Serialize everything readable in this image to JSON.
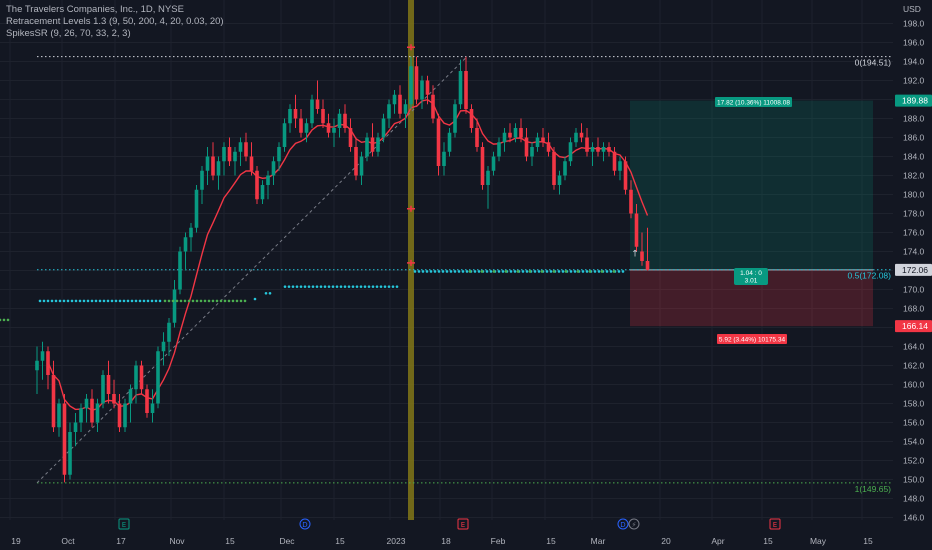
{
  "legend": {
    "symbol": "The Travelers Companies, Inc., 1D, NYSE",
    "indicator1": "Retracement Levels 1.3 (9, 50, 200, 4, 20, 0.03, 20)",
    "indicator2": "SpikesSR (9, 26, 70, 33, 2, 3)"
  },
  "price_axis": {
    "currency": "USD",
    "labels": [
      146,
      148,
      150,
      152,
      154,
      156,
      158,
      160,
      162,
      164,
      166,
      168,
      170,
      172,
      174,
      176,
      178,
      180,
      182,
      184,
      186,
      188,
      190,
      192,
      194,
      196,
      198
    ],
    "tags": [
      {
        "text": "189.88",
        "value": 189.88,
        "bg": "#089981"
      },
      {
        "text": "172.06",
        "value": 172.06,
        "bg": "#d1d4dc"
      },
      {
        "text": "166.14",
        "value": 166.14,
        "bg": "#f23645"
      }
    ]
  },
  "time_axis": {
    "labels": [
      "19",
      "Oct",
      "17",
      "Nov",
      "15",
      "Dec",
      "15",
      "2023",
      "18",
      "Feb",
      "15",
      "Mar",
      "20",
      "Apr",
      "15",
      "May",
      "15"
    ]
  },
  "retracement_labels": [
    {
      "text": "0(194.51)",
      "value": 194.51,
      "color": "#d1d4dc"
    },
    {
      "text": "0.5(172.08)",
      "value": 172.08,
      "color": "#26c6da"
    },
    {
      "text": "1(149.65)",
      "value": 149.65,
      "color": "#4caf50"
    }
  ],
  "position_tool": {
    "target_text": "17.82 (10.36%) 11008.08",
    "entry_text": "1.04 : 0",
    "entry_text2": "3.01",
    "stop_text": "5.92 (3.44%) 10175.34",
    "target": 189.88,
    "entry": 172.06,
    "stop": 166.14,
    "profit_color": "#089981",
    "loss_color": "#f23645"
  },
  "event_markers": [
    {
      "letter": "E",
      "date": "Oct 17",
      "color": "#089981"
    },
    {
      "letter": "D",
      "date": "Dec 8",
      "color": "#2962ff"
    },
    {
      "letter": "E",
      "date": "Jan 24",
      "color": "#f23645"
    },
    {
      "letter": "D",
      "date": "Mar 9",
      "color": "#2962ff"
    },
    {
      "letter": "⚡",
      "date": "Mar 10",
      "color": "#787b86"
    },
    {
      "letter": "E",
      "date": "Apr 20",
      "color": "#f23645"
    }
  ],
  "colors": {
    "background": "#131722",
    "up": "#089981",
    "down": "#f23645",
    "ma_line": "#f23645",
    "cyan": "#26c6da",
    "green": "#4caf50",
    "highlight_bar": "#827717"
  },
  "chart_data": {
    "type": "candlestick",
    "title": "The Travelers Companies, Inc., 1D, NYSE",
    "ylim": [
      145.5,
      200
    ],
    "grid": true,
    "ohlc": [
      [
        161.5,
        164,
        159,
        162.5
      ],
      [
        162.5,
        164.5,
        160.5,
        163.5
      ],
      [
        163.5,
        164,
        159.5,
        161
      ],
      [
        161,
        162.5,
        155,
        155.5
      ],
      [
        155.5,
        158.5,
        154.5,
        158
      ],
      [
        158,
        159,
        149.7,
        150.5
      ],
      [
        150.5,
        156,
        150,
        155
      ],
      [
        155,
        157,
        153.5,
        156
      ],
      [
        156,
        158,
        155,
        157.5
      ],
      [
        157.5,
        159,
        156,
        158.5
      ],
      [
        158.5,
        159.5,
        155.5,
        156
      ],
      [
        156,
        158.5,
        155,
        158
      ],
      [
        158,
        161.5,
        157.5,
        161
      ],
      [
        161,
        162.5,
        158,
        159
      ],
      [
        159,
        160.5,
        157.5,
        158
      ],
      [
        158,
        159,
        155,
        155.5
      ],
      [
        155.5,
        158.5,
        155,
        158
      ],
      [
        158,
        160,
        156,
        159.5
      ],
      [
        159.5,
        162.5,
        158,
        162
      ],
      [
        162,
        162.5,
        159,
        159.5
      ],
      [
        159.5,
        160,
        156.5,
        157
      ],
      [
        157,
        159.5,
        156,
        158
      ],
      [
        158,
        164,
        157.5,
        163.5
      ],
      [
        163.5,
        165.5,
        162,
        164.5
      ],
      [
        164.5,
        167,
        163,
        166.5
      ],
      [
        166.5,
        171,
        166,
        170
      ],
      [
        170,
        174.5,
        169.5,
        174
      ],
      [
        174,
        176,
        172,
        175.5
      ],
      [
        175.5,
        177,
        174,
        176.5
      ],
      [
        176.5,
        181,
        176,
        180.5
      ],
      [
        180.5,
        183,
        179,
        182.5
      ],
      [
        182.5,
        185,
        181,
        184
      ],
      [
        184,
        185.5,
        181.5,
        182
      ],
      [
        182,
        184,
        180.5,
        183.5
      ],
      [
        183.5,
        185.5,
        182,
        185
      ],
      [
        185,
        186,
        183,
        183.5
      ],
      [
        183.5,
        185,
        182,
        184.5
      ],
      [
        184.5,
        186,
        183,
        185.5
      ],
      [
        185.5,
        186.5,
        183.5,
        184
      ],
      [
        184,
        185.5,
        182,
        182.5
      ],
      [
        182.5,
        183,
        179,
        179.5
      ],
      [
        179.5,
        181.5,
        179,
        181
      ],
      [
        181,
        182.5,
        179.5,
        182
      ],
      [
        182,
        184,
        181,
        183.5
      ],
      [
        183.5,
        185.5,
        182.5,
        185
      ],
      [
        185,
        188,
        184.5,
        187.5
      ],
      [
        187.5,
        189.5,
        186.5,
        189
      ],
      [
        189,
        190.5,
        187,
        188
      ],
      [
        188,
        189,
        186,
        186.5
      ],
      [
        186.5,
        188,
        185.5,
        187.5
      ],
      [
        187.5,
        190.5,
        187,
        190
      ],
      [
        190,
        192,
        188.5,
        189
      ],
      [
        189,
        190,
        187,
        187.5
      ],
      [
        187.5,
        188.5,
        186,
        186.5
      ],
      [
        186.5,
        188,
        185,
        187
      ],
      [
        187,
        189,
        186,
        188.5
      ],
      [
        188.5,
        189.5,
        186.5,
        187
      ],
      [
        187,
        188,
        184.5,
        185
      ],
      [
        185,
        186,
        181.5,
        182
      ],
      [
        182,
        184.5,
        181,
        184
      ],
      [
        184,
        186.5,
        183.5,
        186
      ],
      [
        186,
        187.5,
        184,
        184.5
      ],
      [
        184.5,
        186.5,
        184,
        186
      ],
      [
        186,
        188.5,
        185.5,
        188
      ],
      [
        188,
        190,
        187,
        189.5
      ],
      [
        189.5,
        191,
        188.5,
        190.5
      ],
      [
        190.5,
        191.5,
        188,
        188.5
      ],
      [
        188.5,
        190,
        187,
        189.5
      ],
      [
        189.5,
        194.5,
        189,
        193.5
      ],
      [
        193.5,
        194.5,
        189.5,
        190
      ],
      [
        190,
        192.5,
        189,
        192
      ],
      [
        192,
        192.5,
        189.5,
        190.5
      ],
      [
        190.5,
        191.5,
        187.5,
        188
      ],
      [
        188,
        188.5,
        182,
        183
      ],
      [
        183,
        185.5,
        182,
        184.5
      ],
      [
        184.5,
        187,
        184,
        186.5
      ],
      [
        186.5,
        190,
        186,
        189.5
      ],
      [
        189.5,
        194.2,
        189,
        193
      ],
      [
        193,
        194.5,
        188.5,
        189
      ],
      [
        189,
        189.5,
        186.5,
        187
      ],
      [
        187,
        188,
        184.5,
        185
      ],
      [
        185,
        185.5,
        180.5,
        181
      ],
      [
        181,
        183,
        178.5,
        182.5
      ],
      [
        182.5,
        184.5,
        182,
        184
      ],
      [
        184,
        186,
        183.5,
        185.5
      ],
      [
        185.5,
        187,
        184.5,
        186.5
      ],
      [
        186.5,
        187.5,
        185.5,
        186
      ],
      [
        186,
        187.5,
        185.5,
        187
      ],
      [
        187,
        188,
        185.5,
        186
      ],
      [
        186,
        187,
        183.5,
        184
      ],
      [
        184,
        185.5,
        183,
        185
      ],
      [
        185,
        186.5,
        184.5,
        186
      ],
      [
        186,
        187,
        185,
        185.5
      ],
      [
        185.5,
        186.5,
        184,
        184.5
      ],
      [
        184.5,
        185,
        180.5,
        181
      ],
      [
        181,
        182.5,
        180,
        182
      ],
      [
        182,
        184,
        181.5,
        183.5
      ],
      [
        183.5,
        186,
        183,
        185.5
      ],
      [
        185.5,
        187,
        185,
        186.5
      ],
      [
        186.5,
        187.5,
        185.5,
        186
      ],
      [
        186,
        187,
        184,
        184.5
      ],
      [
        184.5,
        185.5,
        183,
        185
      ],
      [
        185,
        186,
        184,
        184.5
      ],
      [
        184.5,
        185.5,
        183.5,
        185
      ],
      [
        185,
        185.5,
        184,
        184.5
      ],
      [
        184.5,
        185,
        182,
        182.5
      ],
      [
        182.5,
        184,
        181.5,
        183.5
      ],
      [
        183.5,
        184,
        180,
        180.5
      ],
      [
        180.5,
        181.5,
        177.5,
        178
      ],
      [
        178,
        179,
        174,
        174.5
      ],
      [
        174,
        176,
        172.5,
        173
      ],
      [
        173,
        176.5,
        172,
        172.06
      ]
    ]
  }
}
